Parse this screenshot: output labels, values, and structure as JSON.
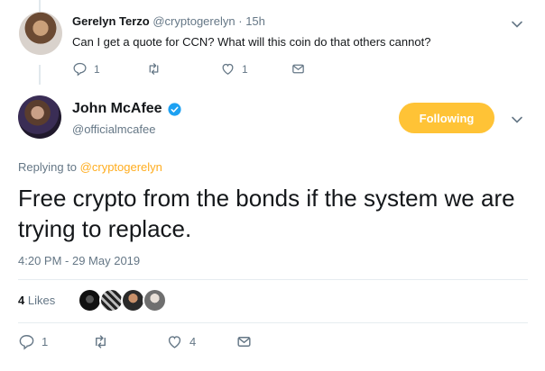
{
  "parent_tweet": {
    "name": "Gerelyn Terzo",
    "handle": "@cryptogerelyn",
    "dot": "·",
    "time": "15h",
    "text": "Can I get a quote for CCN? What will this coin do that others cannot?",
    "reply_count": "1",
    "like_count": "1"
  },
  "tweet": {
    "name": "John McAfee",
    "handle": "@officialmcafee",
    "follow_label": "Following",
    "replying_prefix": "Replying to",
    "replying_to": "@cryptogerelyn",
    "text": "Free crypto from the bonds if the system we are trying to replace.",
    "timestamp": "4:20 PM - 29 May 2019",
    "likes_count": "4",
    "likes_label": "Likes",
    "reply_count": "1",
    "like_count": "4"
  },
  "colors": {
    "accent": "#ffad1f",
    "follow_button": "#ffc336",
    "verified": "#1da1f2",
    "secondary_text": "#657786"
  }
}
